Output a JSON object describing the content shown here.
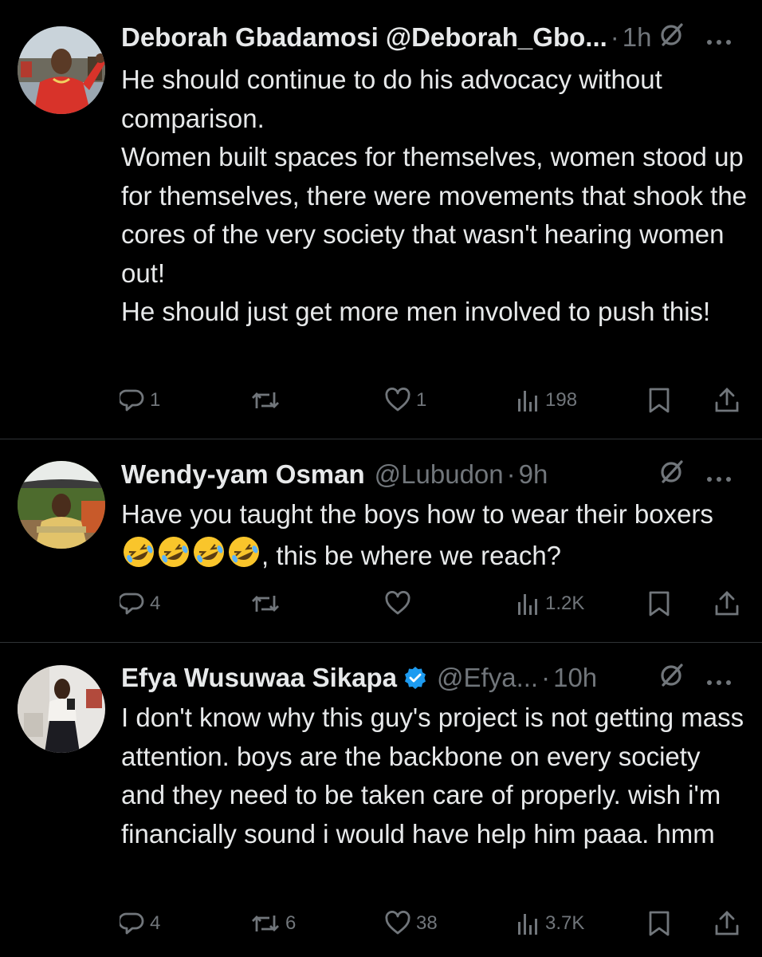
{
  "tweets": [
    {
      "name": "Deborah Gbadamosi @Deborah_Gbo...",
      "handle": "",
      "time": "1h",
      "verified": false,
      "lines": [
        "He should continue to do his advocacy without comparison.",
        "Women built spaces for themselves, women stood up for themselves, there were movements that shook the cores of the very society that wasn't hearing women out!",
        "He should just get more men involved to push this!"
      ],
      "replies": "1",
      "retweets": "",
      "likes": "1",
      "views": "198"
    },
    {
      "name": "Wendy-yam Osman",
      "handle": "@Lubudon",
      "time": "9h",
      "verified": false,
      "text_before_emoji": "Have you taught the boys how to wear their boxers",
      "text_after_emoji": ", this be where we reach?",
      "replies": "4",
      "retweets": "",
      "likes": "",
      "views": "1.2K"
    },
    {
      "name": "Efya Wusuwaa Sikapa",
      "handle": "@Efya...",
      "time": "10h",
      "verified": true,
      "lines": [
        "I don't know why this guy's project is not getting mass attention. boys are the backbone on every society and they need to be taken care of properly. wish i'm financially sound i would have help him paaa. hmm"
      ],
      "replies": "4",
      "retweets": "6",
      "likes": "38",
      "views": "3.7K"
    }
  ],
  "icons": {
    "reply": "reply-icon",
    "retweet": "retweet-icon",
    "like": "heart-icon",
    "views": "views-icon",
    "bookmark": "bookmark-icon",
    "share": "share-icon",
    "grok": "grok-icon",
    "more": "more-icon",
    "verified": "verified-badge-icon",
    "emoji": "rolling-on-floor-laughing-emoji"
  },
  "colors": {
    "background": "#000000",
    "text": "#e7e9ea",
    "secondary": "#71767b",
    "divider": "#2f3336",
    "verified": "#1d9bf0"
  }
}
